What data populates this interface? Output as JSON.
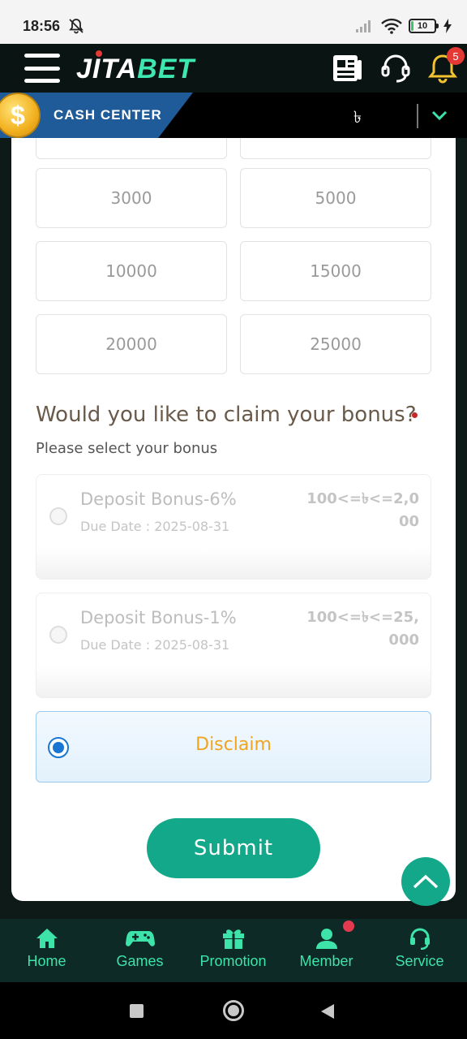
{
  "status_bar": {
    "time": "18:56",
    "battery": "10",
    "battery_level": 0.1
  },
  "header": {
    "logo_part1": "JITA",
    "logo_part2": "BET",
    "notification_count": "5"
  },
  "cash_center": {
    "label": "CASH CENTER",
    "currency_symbol": "৳"
  },
  "amounts": [
    "3000",
    "5000",
    "10000",
    "15000",
    "20000",
    "25000"
  ],
  "bonus_section": {
    "question": "Would you like to claim your bonus?",
    "subtitle": "Please select your bonus",
    "options": [
      {
        "name": "Deposit Bonus-6%",
        "due": "Due Date : 2025-08-31",
        "range": "100<=৳<=2,000"
      },
      {
        "name": "Deposit Bonus-1%",
        "due": "Due Date : 2025-08-31",
        "range": "100<=৳<=25,000"
      }
    ],
    "disclaim_label": "Disclaim"
  },
  "submit_label": "Submit",
  "bottom_nav": [
    "Home",
    "Games",
    "Promotion",
    "Member",
    "Service"
  ],
  "colors": {
    "accent": "#13a88a",
    "nav_text": "#3de3a9",
    "disclaim_text": "#f0a420",
    "brand_blue": "#1f5a99"
  }
}
